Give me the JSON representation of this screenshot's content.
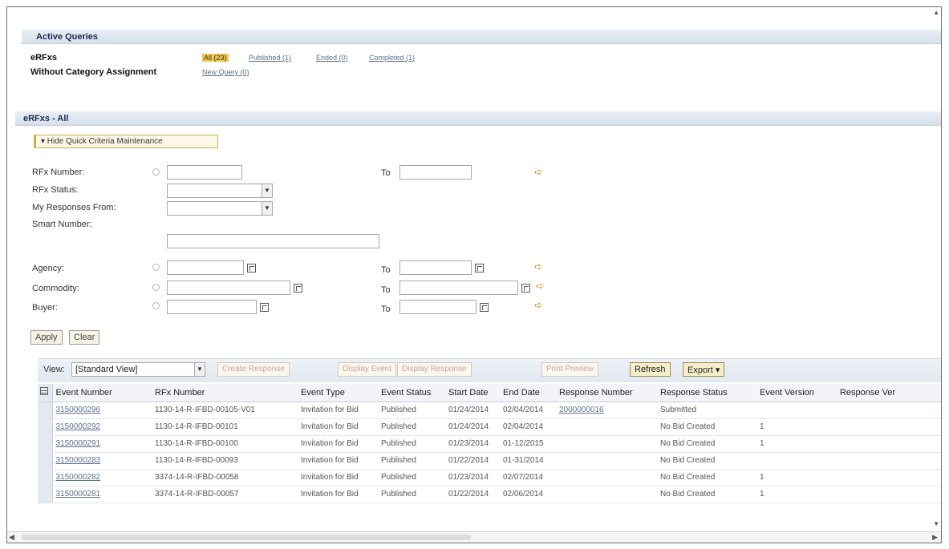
{
  "active_queries": {
    "title": "Active Queries",
    "erfxs_label": "eRFxs",
    "erfxs_links": [
      "All (23)",
      "Published (1)",
      "Ended (0)",
      "Completed (1)"
    ],
    "without_cat_label": "Without Category Assignment",
    "new_query_link": "New Query (0)"
  },
  "erfxs_all": {
    "title": "eRFxs - All",
    "toggle_label": "▾ Hide Quick Criteria Maintenance"
  },
  "criteria": {
    "rfx_number": "RFx Number:",
    "rfx_status": "RFx Status:",
    "my_responses_from": "My Responses From:",
    "smart_number": "Smart Number:",
    "agency": "Agency:",
    "commodity": "Commodity:",
    "buyer": "Buyer:",
    "to": "To",
    "apply": "Apply",
    "clear": "Clear"
  },
  "toolbar": {
    "view_label": "View:",
    "view_value": "[Standard View]",
    "create_response": "Create Response",
    "display_event": "Display Event",
    "display_response": "Display Response",
    "print_preview": "Print Preview",
    "refresh": "Refresh",
    "export": "Export ▾"
  },
  "table": {
    "columns": [
      "Event Number",
      "RFx Number",
      "Event Type",
      "Event Status",
      "Start Date",
      "End Date",
      "Response Number",
      "Response Status",
      "Event Version",
      "Response Ver"
    ],
    "rows": [
      [
        "3150000296",
        "1130-14-R-IFBD-00105-V01",
        "Invitation for Bid",
        "Published",
        "01/24/2014",
        "02/04/2014",
        "2000000016",
        "Submitted",
        "",
        ""
      ],
      [
        "3150000292",
        "1130-14-R-IFBD-00101",
        "Invitation for Bid",
        "Published",
        "01/24/2014",
        "02/04/2014",
        "",
        "No Bid Created",
        "1",
        ""
      ],
      [
        "3150000291",
        "1130-14-R-IFBD-00100",
        "Invitation for Bid",
        "Published",
        "01/23/2014",
        "01-12/2015",
        "",
        "No Bid Created",
        "1",
        ""
      ],
      [
        "3150000283",
        "1130-14-R-IFBD-00093",
        "Invitation for Bid",
        "Published",
        "01/22/2014",
        "01-31/2014",
        "",
        "No Bid Created",
        "",
        ""
      ],
      [
        "3150000282",
        "3374-14-R-IFBD-00058",
        "Invitation for Bid",
        "Published",
        "01/23/2014",
        "02/07/2014",
        "",
        "No Bid Created",
        "1",
        ""
      ],
      [
        "3150000281",
        "3374-14-R-IFBD-00057",
        "Invitation for Bid",
        "Published",
        "01/22/2014",
        "02/06/2014",
        "",
        "No Bid Created",
        "1",
        ""
      ]
    ]
  }
}
